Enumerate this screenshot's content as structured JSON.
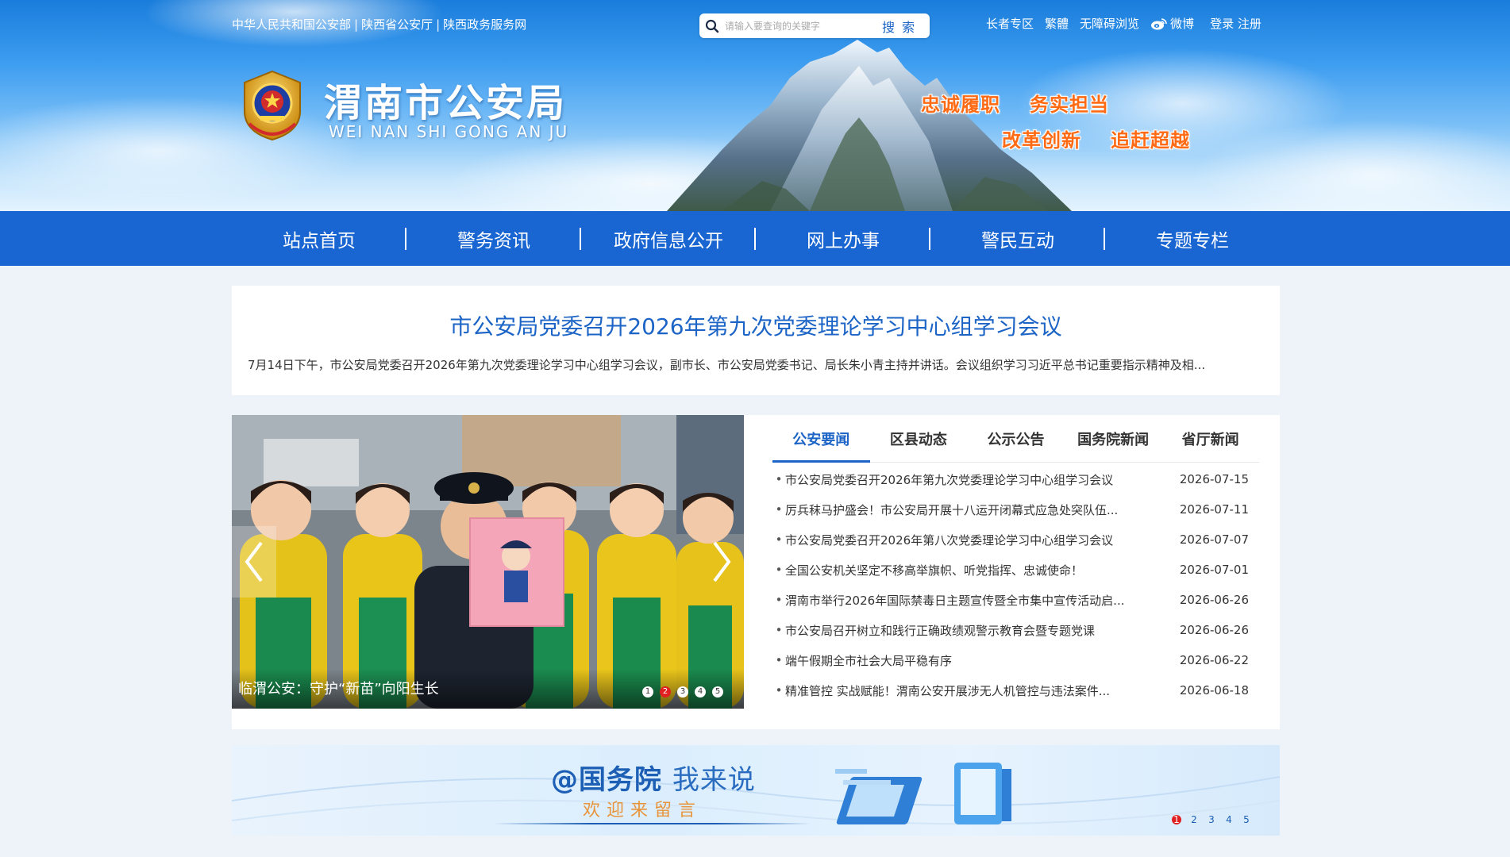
{
  "header": {
    "top_links": [
      "中华人民共和国公安部",
      "陕西省公安厅",
      "陕西政务服务网"
    ],
    "search": {
      "placeholder": "请输入要查询的关键字",
      "button_label": "搜 索"
    },
    "util_links": {
      "elderly": "长者专区",
      "traditional": "繁體",
      "accessible": "无障碍浏览",
      "weibo": "微博",
      "login": "登录",
      "register": "注册"
    },
    "site_title": "渭南市公安局",
    "site_subtitle": "WEI NAN SHI GONG AN JU",
    "slogans": [
      "忠诚履职",
      "务实担当",
      "改革创新",
      "追赶超越"
    ]
  },
  "nav": {
    "items": [
      "站点首页",
      "警务资讯",
      "政府信息公开",
      "网上办事",
      "警民互动",
      "专题专栏"
    ]
  },
  "headline": {
    "title": "市公安局党委召开2026年第九次党委理论学习中心组学习会议",
    "summary": "7月14日下午，市公安局党委召开2026年第九次党委理论学习中心组学习会议，副市长、市公安局党委书记、局长朱小青主持并讲话。会议组织学习习近平总书记重要指示精神及相..."
  },
  "carousel": {
    "caption": "临渭公安：守护“新苗”向阳生长",
    "dots": [
      "1",
      "2",
      "3",
      "4",
      "5"
    ],
    "active_dot": 2
  },
  "news": {
    "tabs": [
      "公安要闻",
      "区县动态",
      "公示公告",
      "国务院新闻",
      "省厅新闻"
    ],
    "active_tab": 0,
    "bullet": "•",
    "items": [
      {
        "title": "市公安局党委召开2026年第九次党委理论学习中心组学习会议",
        "date": "2026-07-15"
      },
      {
        "title": "厉兵秣马护盛会！市公安局开展十八运开闭幕式应急处突队伍...",
        "date": "2026-07-11"
      },
      {
        "title": "市公安局党委召开2026年第八次党委理论学习中心组学习会议",
        "date": "2026-07-07"
      },
      {
        "title": "全国公安机关坚定不移高举旗帜、听党指挥、忠诚使命！",
        "date": "2026-07-01"
      },
      {
        "title": "渭南市举行2026年国际禁毒日主题宣传暨全市集中宣传活动启...",
        "date": "2026-06-26"
      },
      {
        "title": "市公安局召开树立和践行正确政绩观警示教育会暨专题党课",
        "date": "2026-06-26"
      },
      {
        "title": "端午假期全市社会大局平稳有序",
        "date": "2026-06-22"
      },
      {
        "title": "精准管控 实战赋能！渭南公安开展涉无人机管控与违法案件...",
        "date": "2026-06-18"
      }
    ]
  },
  "banner": {
    "main_bold": "@国务院",
    "main_light": "我来说",
    "sub": "欢迎来留言",
    "dots": [
      "1",
      "2",
      "3",
      "4",
      "5"
    ],
    "active_dot": 0
  },
  "colors": {
    "nav_bg": "#1966d2",
    "accent": "#1c64c6",
    "slogan": "#ff6a14",
    "dot_active": "#e02020"
  },
  "icons": {
    "search": "search-icon",
    "weibo": "weibo-icon",
    "emblem": "police-emblem-icon",
    "prev": "chevron-left-icon",
    "next": "chevron-right-icon"
  }
}
